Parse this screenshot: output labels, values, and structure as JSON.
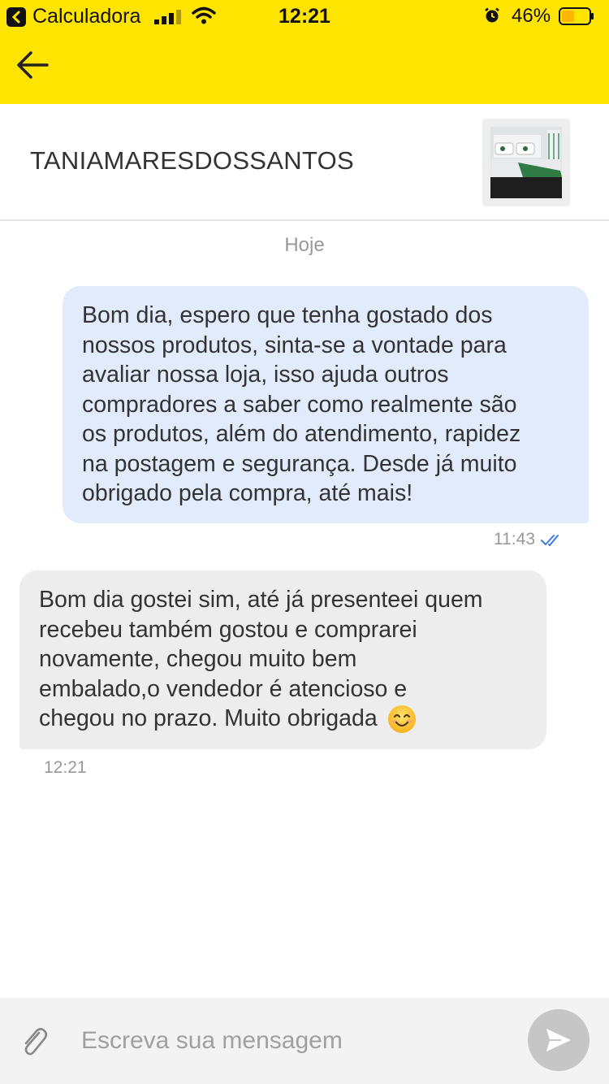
{
  "status_bar": {
    "back_app": "Calculadora",
    "time": "12:21",
    "battery_percent": "46%",
    "battery_level": 0.46
  },
  "chat": {
    "contact_name": "TANIAMARESDOSSANTOS",
    "date_separator": "Hoje",
    "messages": [
      {
        "direction": "out",
        "text": "Bom dia, espero que tenha gostado dos\nnossos produtos, sinta-se a vontade para\navaliar nossa loja, isso ajuda outros\ncompradores a saber como realmente são\nos produtos, além do atendimento, rapidez\nna postagem e segurança. Desde já muito\nobrigado pela compra, até mais!",
        "time": "11:43",
        "status": "read"
      },
      {
        "direction": "in",
        "text": "Bom dia gostei sim, até já presenteei quem\nrecebeu também gostou e comprarei\nnovamente, chegou muito bem\nembalado,o vendedor é atencioso e\nchegou no prazo. Muito obrigada",
        "emoji": "😊",
        "time": "12:21"
      }
    ]
  },
  "composer": {
    "placeholder": "Escreva sua mensagem"
  },
  "icons": {
    "back": "arrow-left-icon",
    "attach": "paperclip-icon",
    "send": "send-icon",
    "read_receipt": "double-check-icon"
  },
  "colors": {
    "header_yellow": "#ffe400",
    "outgoing_bubble": "#e1ebfb",
    "incoming_bubble": "#ededed",
    "check_blue": "#3d7be0",
    "send_button": "#c6c6c6"
  }
}
